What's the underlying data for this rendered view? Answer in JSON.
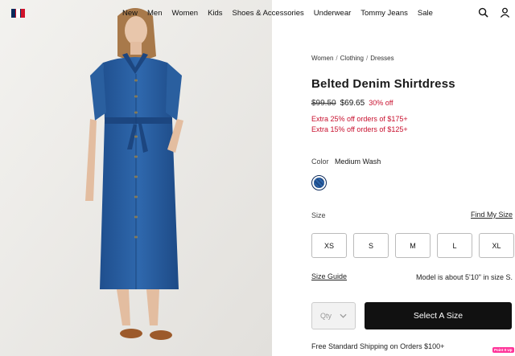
{
  "header": {
    "logo": "tommy-hilfiger-flag-logo",
    "nav": [
      "New",
      "Men",
      "Women",
      "Kids",
      "Shoes & Accessories",
      "Underwear",
      "Tommy Jeans",
      "Sale"
    ],
    "icons": [
      "search-icon",
      "user-icon"
    ]
  },
  "breadcrumb": [
    "Women",
    "Clothing",
    "Dresses"
  ],
  "product": {
    "title": "Belted Denim Shirtdress",
    "price_original": "$99.50",
    "price_sale": "$69.65",
    "discount": "30% off",
    "promos": [
      "Extra 25% off orders of $175+",
      "Extra 15% off orders of $125+"
    ]
  },
  "color": {
    "label": "Color",
    "value": "Medium Wash",
    "swatch_color": "#2a5c9c"
  },
  "size": {
    "label": "Size",
    "find_size_link": "Find My Size",
    "options": [
      "XS",
      "S",
      "M",
      "L",
      "XL"
    ],
    "guide_link": "Size Guide",
    "model_info": "Model is about 5'10\" in size S."
  },
  "actions": {
    "qty_placeholder": "Qty",
    "select_button": "Select A Size"
  },
  "shipping": "Free Standard Shipping on Orders $100+",
  "badge": "Point It Up",
  "colors": {
    "sale_red": "#c8102e",
    "brand_navy": "#0c2a5b",
    "brand_red": "#d0132b",
    "button_black": "#111111"
  }
}
